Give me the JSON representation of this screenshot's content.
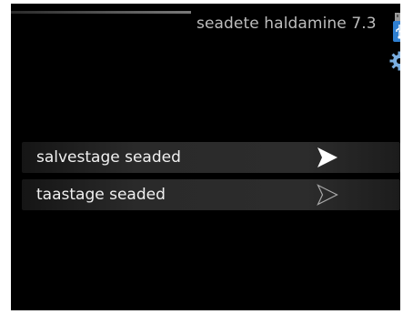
{
  "header": {
    "title": "seadete haldamine 7.3",
    "icons": [
      "usb-icon",
      "gear-icon"
    ]
  },
  "menu": {
    "items": [
      {
        "label": "salvestage seaded",
        "icon": "arrow-right-filled-icon",
        "selected": true
      },
      {
        "label": "taastage seaded",
        "icon": "arrow-right-outline-icon",
        "selected": false
      }
    ]
  },
  "colors": {
    "background": "#000000",
    "text": "#f0f0f0",
    "title": "#bdbdbd",
    "accent_blue": "#2f7fd0"
  }
}
